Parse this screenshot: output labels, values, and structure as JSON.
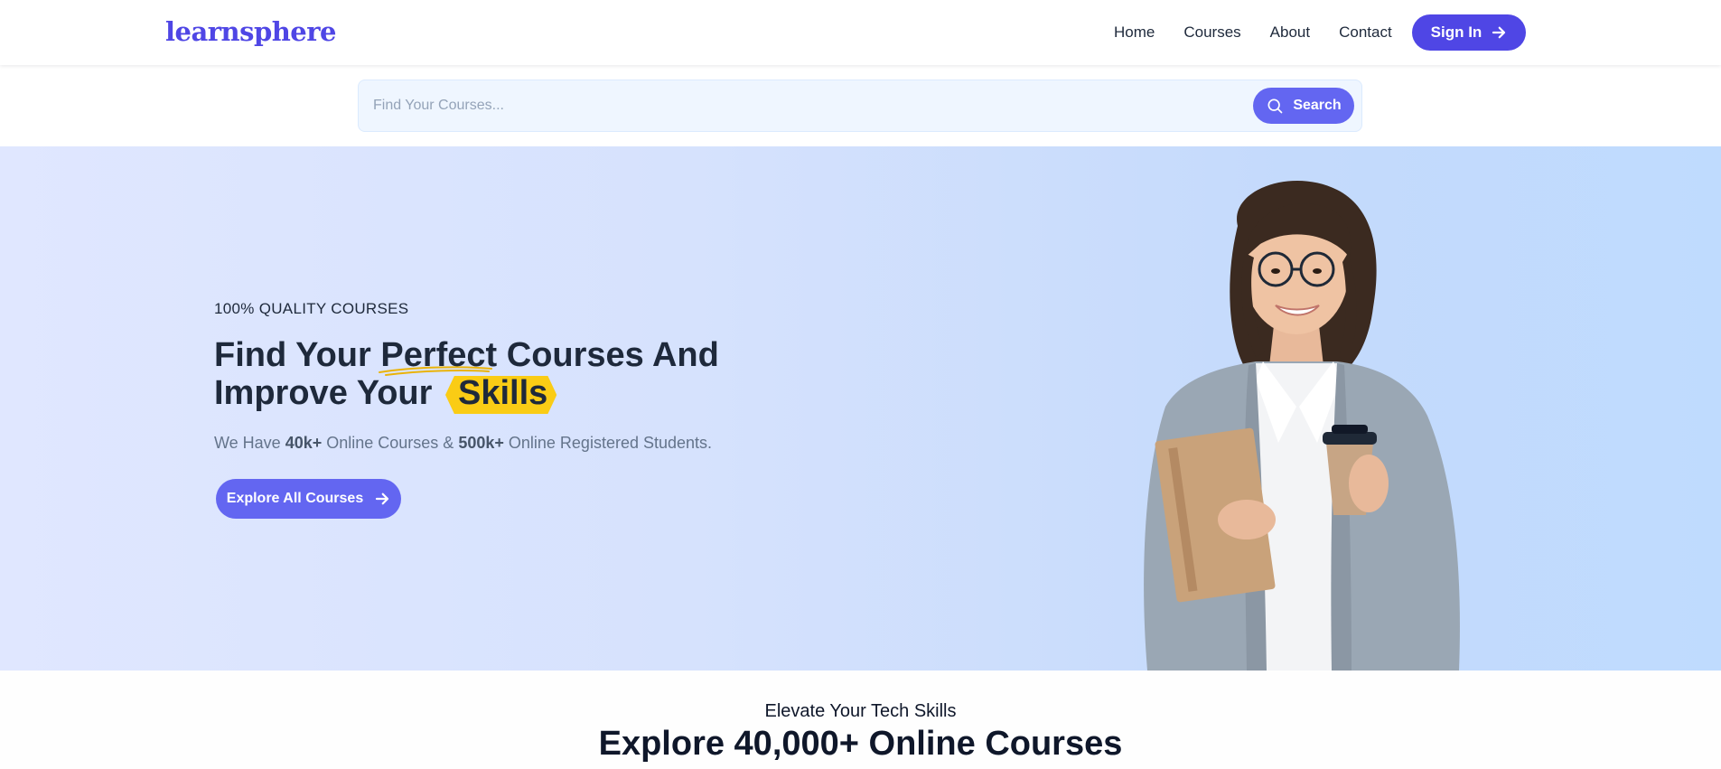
{
  "brand": {
    "logo_text": "learnsphere",
    "accent_color": "#4f46e5"
  },
  "nav": {
    "links": [
      "Home",
      "Courses",
      "About",
      "Contact"
    ],
    "signin_label": "Sign In"
  },
  "search": {
    "placeholder": "Find Your Courses...",
    "value": "",
    "button_label": "Search",
    "icon": "search-icon"
  },
  "hero": {
    "eyebrow": "100% QUALITY COURSES",
    "headline_part1": "Find Your ",
    "headline_underlined": "Perfect",
    "headline_part2": " Courses And",
    "headline_line2": "Improve Your",
    "headline_badge": "Skills",
    "sub_prefix": "We Have ",
    "sub_stat1": "40k+",
    "sub_middle": " Online Courses & ",
    "sub_stat2": "500k+",
    "sub_suffix": " Online Registered Students.",
    "cta_label": "Explore All Courses",
    "background_colors": [
      "#e0e7ff",
      "#bfdbfe"
    ],
    "badge_color": "#facc15"
  },
  "section": {
    "kicker": "Elevate Your Tech Skills",
    "title": "Explore 40,000+ Online Courses"
  }
}
